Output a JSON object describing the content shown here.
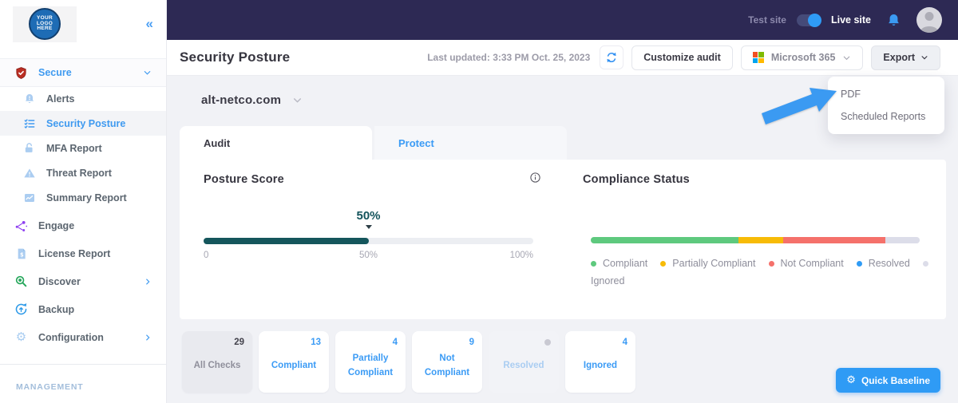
{
  "colors": {
    "topbar": "#2d2954",
    "accent_blue": "#3b9af2",
    "posture_teal": "#15565c",
    "compliant_green": "#5ec97e",
    "partial_yellow": "#f7bb07",
    "noncompliant_red": "#f5716b",
    "resolved_blue": "#2f9bf5",
    "ignored_lavender": "#dcdde9"
  },
  "brand": {
    "logo_line1": "YOUR",
    "logo_line2": "LOGO",
    "logo_line3": "HERE"
  },
  "topbar": {
    "test_label": "Test site",
    "live_label": "Live site",
    "toggle_state": "on"
  },
  "sidebar": {
    "items": [
      {
        "label": "Secure",
        "icon": "shield-check"
      },
      {
        "label": "Alerts",
        "icon": "bell-alert"
      },
      {
        "label": "Security Posture",
        "icon": "checklist"
      },
      {
        "label": "MFA Report",
        "icon": "lock"
      },
      {
        "label": "Threat Report",
        "icon": "warning-triangle"
      },
      {
        "label": "Summary Report",
        "icon": "line-chart"
      },
      {
        "label": "Engage",
        "icon": "share-network"
      },
      {
        "label": "License Report",
        "icon": "invoice-dollar"
      },
      {
        "label": "Discover",
        "icon": "magnifier"
      },
      {
        "label": "Backup",
        "icon": "backup-arrow"
      },
      {
        "label": "Configuration",
        "icon": "gear"
      }
    ],
    "management_label": "MANAGEMENT"
  },
  "header": {
    "title": "Security Posture",
    "last_updated": "Last updated: 3:33 PM Oct. 25, 2023",
    "customize_label": "Customize audit",
    "tenant_selected": "Microsoft 365",
    "export_label": "Export"
  },
  "export_menu": {
    "items": [
      "PDF",
      "Scheduled Reports"
    ]
  },
  "main": {
    "org": "alt-netco.com",
    "tabs": [
      {
        "label": "Audit",
        "active": true
      },
      {
        "label": "Protect",
        "active": false
      }
    ],
    "posture": {
      "title": "Posture Score",
      "value_label": "50%",
      "percent": 50,
      "color": "#15565c",
      "tick_0": "0",
      "tick_50": "50%",
      "tick_100": "100%"
    },
    "compliance": {
      "title": "Compliance Status",
      "segments": [
        {
          "name": "Compliant",
          "percent": 44.8,
          "color": "#5ec97e"
        },
        {
          "name": "Partially Compliant",
          "percent": 13.8,
          "color": "#f7bb07"
        },
        {
          "name": "Not Compliant",
          "percent": 31.0,
          "color": "#f5716b"
        },
        {
          "name": "Ignored",
          "percent": 10.4,
          "color": "#dcdde9"
        }
      ],
      "legend": [
        {
          "label": "Compliant",
          "color": "#5ec97e"
        },
        {
          "label": "Partially Compliant",
          "color": "#f7bb07"
        },
        {
          "label": "Not Compliant",
          "color": "#f5716b"
        },
        {
          "label": "Resolved",
          "color": "#2f9bf5"
        },
        {
          "label": "Ignored",
          "color": "#dcdde9"
        }
      ]
    },
    "cards": [
      {
        "value": "29",
        "label": "All Checks"
      },
      {
        "value": "13",
        "label": "Compliant"
      },
      {
        "value": "4",
        "label": "Partially Compliant"
      },
      {
        "value": "9",
        "label": "Not Compliant"
      },
      {
        "value": "",
        "label": "Resolved"
      },
      {
        "value": "4",
        "label": "Ignored"
      }
    ],
    "quick_baseline_label": "Quick Baseline"
  }
}
